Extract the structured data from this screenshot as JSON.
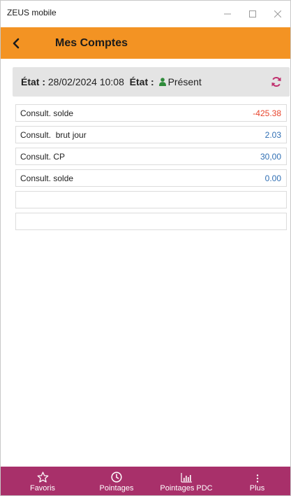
{
  "window": {
    "title": "ZEUS mobile"
  },
  "header": {
    "title": "Mes Comptes"
  },
  "status": {
    "label1": "État :",
    "datetime": "28/02/2024 10:08",
    "label2": "État :",
    "presence": "Présent"
  },
  "rows": [
    {
      "label": "Consult. solde",
      "value": "-425.38"
    },
    {
      "label": "Consult.  brut jour",
      "value": "2.03"
    },
    {
      "label": "Consult. CP",
      "value": "30,00"
    },
    {
      "label": "Consult. solde",
      "value": "0.00"
    },
    {
      "label": "",
      "value": ""
    },
    {
      "label": "",
      "value": ""
    }
  ],
  "nav": {
    "items": [
      {
        "label": "Favoris",
        "icon": "star-icon"
      },
      {
        "label": "Pointages",
        "icon": "clock-icon"
      },
      {
        "label": "Pointages PDC",
        "icon": "bar-chart-icon"
      },
      {
        "label": "Plus",
        "icon": "more-vertical-icon"
      }
    ]
  },
  "colors": {
    "header": "#f39323",
    "nav": "#a8306a",
    "negative": "#e8452c",
    "positive": "#2f6eb3",
    "presence": "#2e8b3a",
    "refresh": "#c0306e"
  }
}
